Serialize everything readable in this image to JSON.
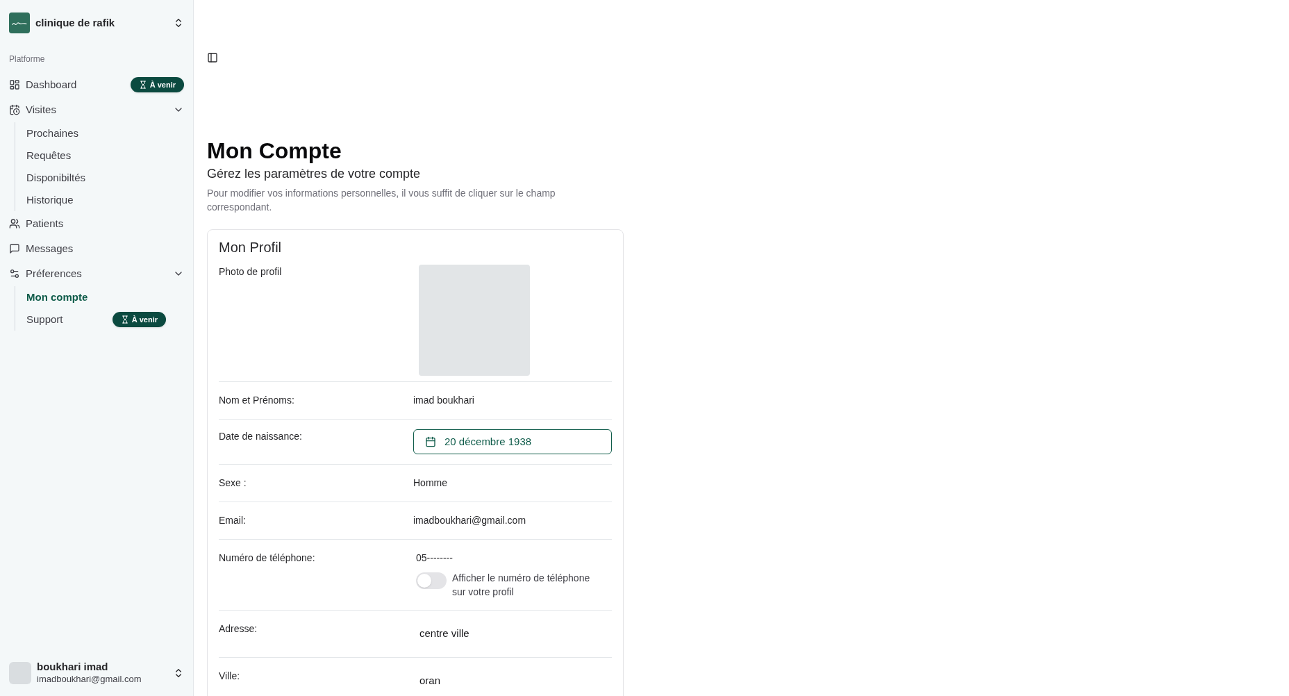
{
  "sidebar": {
    "org": {
      "name": "clinique de rafik"
    },
    "group_label": "Platforme",
    "items": [
      {
        "label": "Dashboard",
        "badge": "À venir"
      },
      {
        "label": "Visites",
        "expanded": true,
        "children": [
          {
            "label": "Prochaines",
            "selected": false
          },
          {
            "label": "Requêtes",
            "selected": false
          },
          {
            "label": "Disponibiltés",
            "selected": false
          },
          {
            "label": "Historique",
            "selected": false
          }
        ]
      },
      {
        "label": "Patients"
      },
      {
        "label": "Messages"
      },
      {
        "label": "Préferences",
        "expanded": true,
        "children": [
          {
            "label": "Mon compte",
            "selected": true
          },
          {
            "label": "Support",
            "selected": false,
            "badge": "À venir"
          }
        ]
      }
    ],
    "user": {
      "name": "boukhari imad",
      "email": "imadboukhari@gmail.com"
    }
  },
  "page": {
    "title": "Mon Compte",
    "subtitle": "Gérez les paramètres de votre compte",
    "description": "Pour modifier vos informations personnelles, il vous suffit de cliquer sur le champ correspondant."
  },
  "profile": {
    "title": "Mon Profil",
    "fields": [
      {
        "kind": "photo",
        "label": "Photo de profil"
      },
      {
        "kind": "text",
        "label": "Nom et Prénoms:",
        "value": "imad boukhari"
      },
      {
        "kind": "date",
        "label": "Date de naissance:",
        "value": "20 décembre 1938"
      },
      {
        "kind": "text",
        "label": "Sexe :",
        "value": "Homme"
      },
      {
        "kind": "text",
        "label": "Email:",
        "value": "imadboukhari@gmail.com"
      },
      {
        "kind": "phone",
        "label": "Numéro de téléphone:",
        "value": "05--------",
        "toggle": {
          "label": "Afficher le numéro de téléphone sur votre profil",
          "on": false
        }
      },
      {
        "kind": "editable",
        "label": "Adresse:",
        "value": "centre ville"
      },
      {
        "kind": "editable",
        "label": "Ville:",
        "value": "oran"
      }
    ]
  }
}
